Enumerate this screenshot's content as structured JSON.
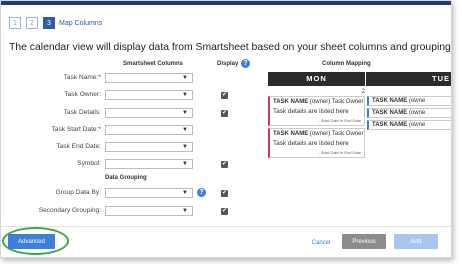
{
  "wizard": {
    "steps": [
      "1",
      "2",
      "3"
    ],
    "current_step_title": "Map Columns",
    "headline": "The calendar view will display data from Smartsheet based on your sheet columns and grouping."
  },
  "columns": {
    "smartsheet_header": "Smartsheet Columns",
    "display_header": "Display",
    "mapping_header": "Column Mapping"
  },
  "fields": [
    {
      "label": "Task Name:",
      "required": true,
      "display_checked": false
    },
    {
      "label": "Task Owner:",
      "required": false,
      "display_checked": true
    },
    {
      "label": "Task Details:",
      "required": false,
      "display_checked": true
    },
    {
      "label": "Task Start Date:",
      "required": true,
      "display_checked": false
    },
    {
      "label": "Task End Date:",
      "required": false,
      "display_checked": false
    },
    {
      "label": "Symbol:",
      "required": false,
      "display_checked": true
    }
  ],
  "grouping": {
    "section_title": "Data Grouping",
    "fields": [
      {
        "label": "Group Data By:",
        "display_checked": true
      },
      {
        "label": "Secondary Grouping:",
        "display_checked": true
      }
    ]
  },
  "preview": {
    "days": [
      "MON",
      "TUE"
    ],
    "day_number": "2",
    "card_task_name": "TASK NAME",
    "card_owner": "(owner) Task Owner",
    "card_owner_truncated": "(owne",
    "card_details": "Task details are listed here",
    "card_dates": "- Start Date to End Date"
  },
  "buttons": {
    "advanced": "Advanced",
    "cancel": "Cancel",
    "previous": "Previous",
    "add": "Add"
  },
  "icons": {
    "help": "?",
    "caret": "▼",
    "check": "✔"
  },
  "colors": {
    "accent": "#3f7fdc",
    "wizard_blue": "#2e5caa",
    "card_red": "#c63a5c",
    "highlight_green": "#39a845"
  }
}
